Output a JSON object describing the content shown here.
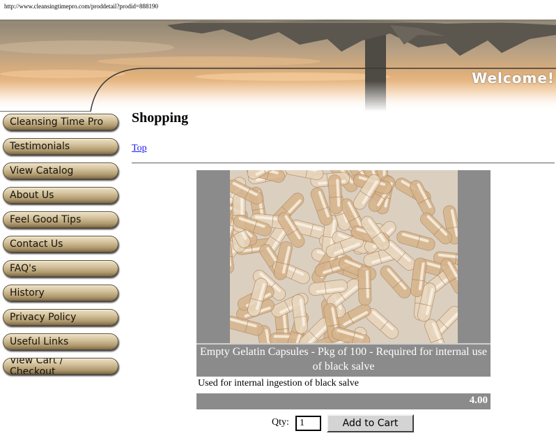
{
  "browser": {
    "url": "http://www.cleansingtimepro.com/proddetail?prodid=888190"
  },
  "header": {
    "welcome": "Welcome!"
  },
  "sidebar": {
    "items": [
      {
        "label": "Cleansing Time Pro"
      },
      {
        "label": "Testimonials"
      },
      {
        "label": "View Catalog"
      },
      {
        "label": "About Us"
      },
      {
        "label": "Feel Good Tips"
      },
      {
        "label": "Contact Us"
      },
      {
        "label": "FAQ's"
      },
      {
        "label": "History"
      },
      {
        "label": "Privacy Policy"
      },
      {
        "label": "Useful Links"
      },
      {
        "label": "View Cart / Checkout"
      }
    ]
  },
  "main": {
    "title": "Shopping",
    "top_link": "Top",
    "product": {
      "name": "Empty Gelatin Capsules - Pkg of 100 - Required for internal use of black salve",
      "description": "Used for internal ingestion of black salve",
      "price": "4.00",
      "qty_label": "Qty:",
      "qty_value": "1",
      "add_button": "Add to Cart"
    }
  },
  "colors": {
    "panel_gray": "#8b8b8b",
    "nav_button": "#c9b78f",
    "link": "#1a1aee"
  }
}
